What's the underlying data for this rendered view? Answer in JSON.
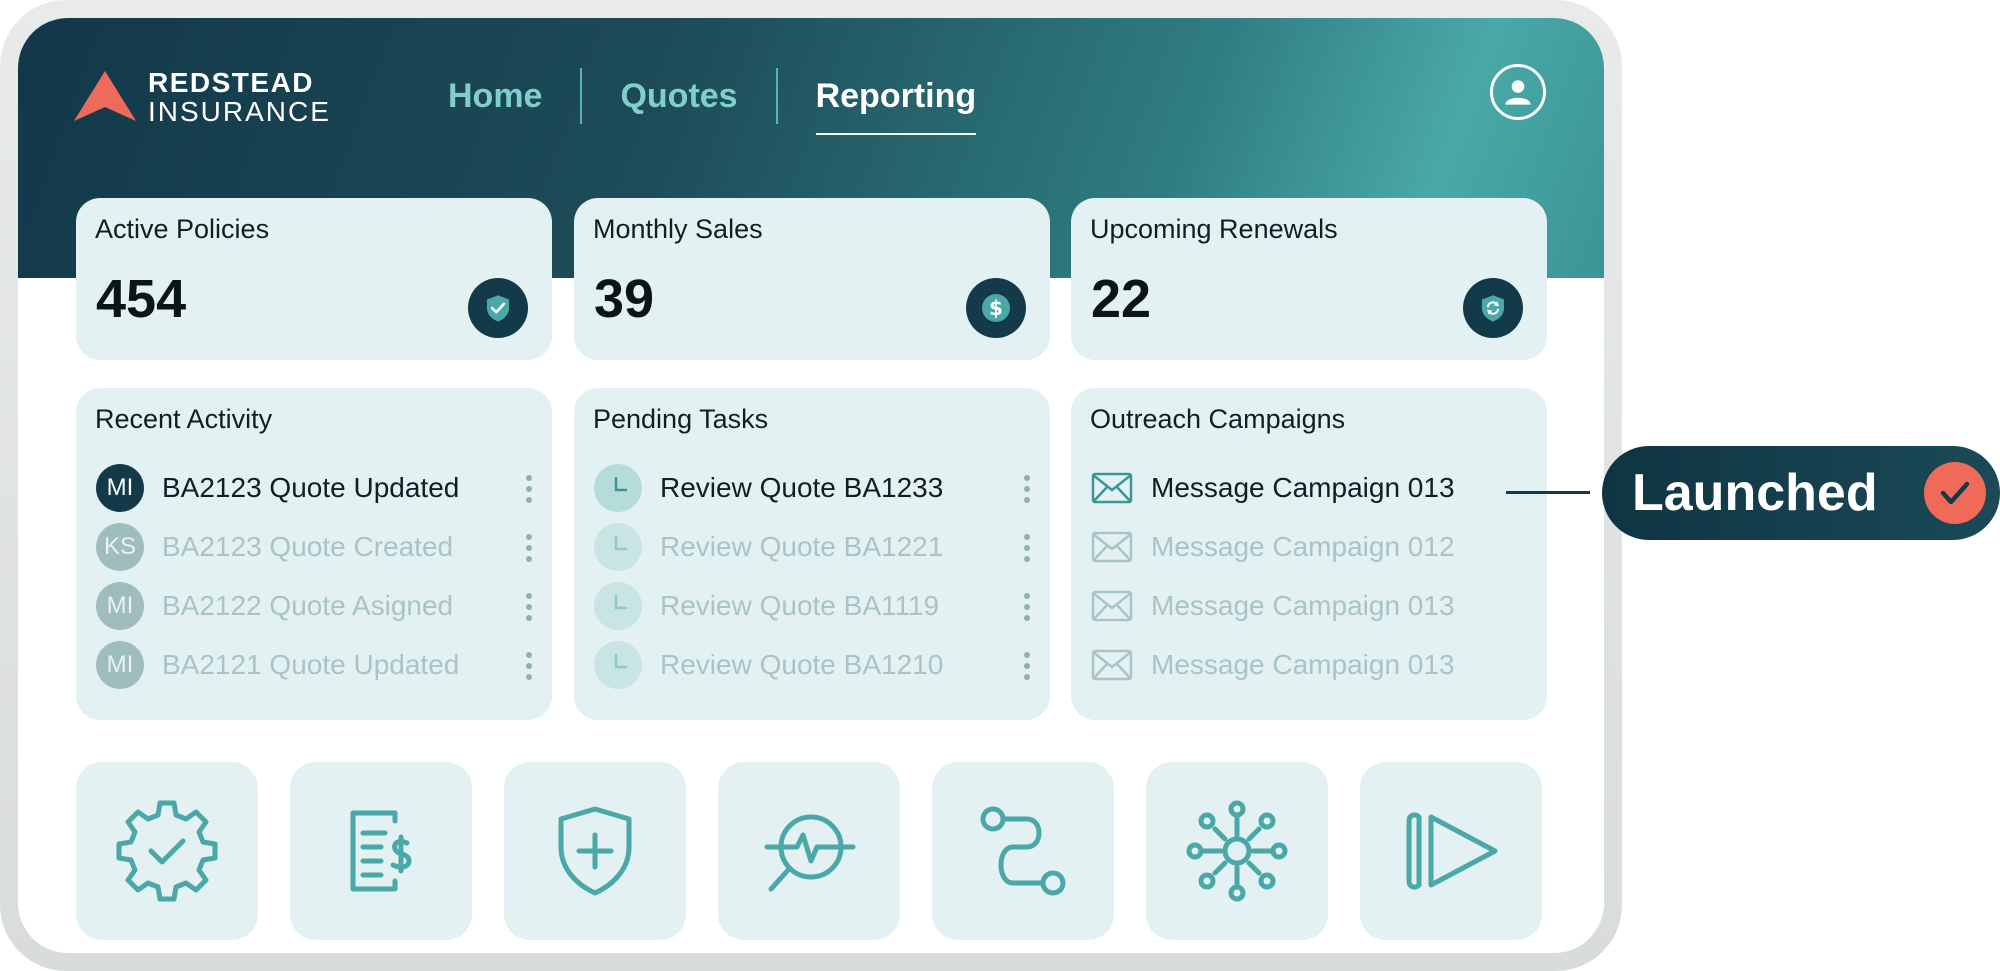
{
  "brand": {
    "line1": "REDSTEAD",
    "line2": "INSURANCE",
    "accent_color": "#f06a5a"
  },
  "nav": {
    "items": [
      "Home",
      "Quotes",
      "Reporting"
    ],
    "active": "Reporting"
  },
  "stats": [
    {
      "title": "Active Policies",
      "value": "454",
      "icon": "shield-check-icon"
    },
    {
      "title": "Monthly Sales",
      "value": "39",
      "icon": "dollar-icon"
    },
    {
      "title": "Upcoming Renewals",
      "value": "22",
      "icon": "shield-refresh-icon"
    }
  ],
  "recent_activity": {
    "title": "Recent Activity",
    "items": [
      {
        "initials": "MI",
        "text": "BA2123 Quote Updated"
      },
      {
        "initials": "KS",
        "text": "BA2123 Quote Created"
      },
      {
        "initials": "MI",
        "text": "BA2122 Quote Asigned"
      },
      {
        "initials": "MI",
        "text": "BA2121 Quote Updated"
      }
    ]
  },
  "pending_tasks": {
    "title": "Pending Tasks",
    "items": [
      "Review Quote BA1233",
      "Review Quote BA1221",
      "Review Quote BA1119",
      "Review Quote BA1210"
    ]
  },
  "outreach": {
    "title": "Outreach Campaigns",
    "items": [
      "Message Campaign 013",
      "Message Campaign 012",
      "Message Campaign 013",
      "Message Campaign 013"
    ]
  },
  "tiles": [
    "gear-check-icon",
    "invoice-dollar-icon",
    "shield-plus-icon",
    "analytics-search-icon",
    "workflow-path-icon",
    "network-hub-icon",
    "fast-forward-icon"
  ],
  "callout": {
    "label": "Launched",
    "icon": "check-icon"
  },
  "colors": {
    "primary_dark": "#123a48",
    "teal": "#4aa8a8",
    "card_bg": "#e4f1f2"
  }
}
